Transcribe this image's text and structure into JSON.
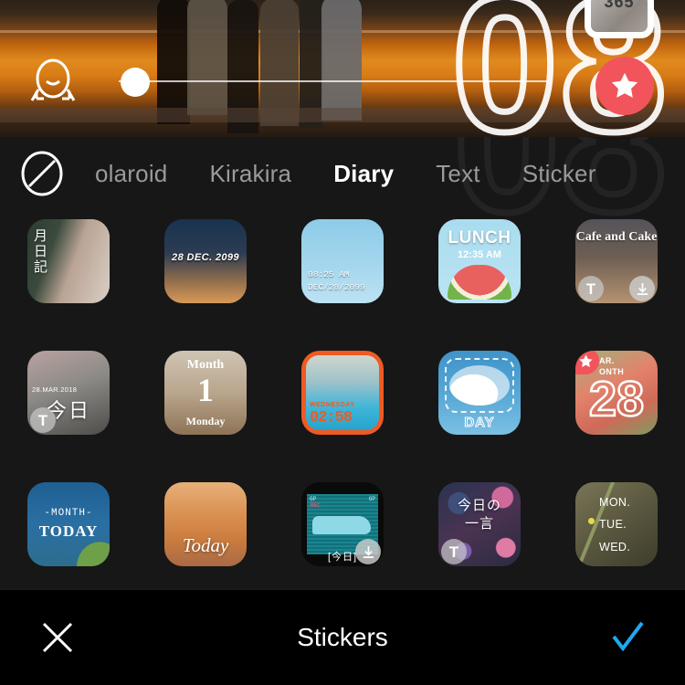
{
  "preview": {
    "overlay_number": "08",
    "badge_thumb_label": "365",
    "face_icon": "smile-face-icon",
    "star_icon": "star-icon",
    "slider": {
      "name": "opacity-slider",
      "value": 0
    }
  },
  "tabs": {
    "none_icon": "no-effect-icon",
    "items": [
      {
        "label": "olaroid",
        "active": false,
        "clipped": true
      },
      {
        "label": "Kirakira",
        "active": false
      },
      {
        "label": "Diary",
        "active": true
      },
      {
        "label": "Text",
        "active": false
      },
      {
        "label": "Sticker",
        "active": false
      }
    ]
  },
  "grid": {
    "selected_index": 9,
    "selection_color": "#29a9ee",
    "items": [
      {
        "name": "sticker-vertical-jp-portrait",
        "text": "月日記",
        "badges": []
      },
      {
        "name": "sticker-28-dec-2099",
        "text": "28 DEC. 2099",
        "badges": []
      },
      {
        "name": "sticker-time-date-palm",
        "time": "08:25 AM",
        "date": "DEC/28/2099",
        "badges": []
      },
      {
        "name": "sticker-lunch-watermelon",
        "title": "LUNCH",
        "time": "12:35 AM",
        "badges": []
      },
      {
        "name": "sticker-cafe-and-cake",
        "text": "Cafe and Cake",
        "badges": [
          "T",
          "download"
        ]
      },
      {
        "name": "sticker-kyou-clock",
        "date": "28.MAR.2018",
        "text": "今日",
        "badges": [
          "T"
        ]
      },
      {
        "name": "sticker-month-1-monday",
        "month": "Month",
        "day_number": "1",
        "weekday": "Monday",
        "badges": []
      },
      {
        "name": "sticker-wednesday-digital-clock",
        "weekday": "WEDNESDAY",
        "time": "02:58",
        "badges": []
      },
      {
        "name": "sticker-cloud-day",
        "label": "DAY",
        "badges": []
      },
      {
        "name": "sticker-mar-month-28",
        "line1": "AR.",
        "line2": "ONTH",
        "number": "28",
        "badges": [
          "star"
        ]
      },
      {
        "name": "sticker-month-today-palm",
        "line1": "-MONTH-",
        "line2": "TODAY",
        "badges": []
      },
      {
        "name": "sticker-today-burger",
        "text": "Today",
        "badges": []
      },
      {
        "name": "sticker-retro-camcorder-kyou",
        "rec": "REC",
        "tl": "GP",
        "tr": "GP",
        "text": "[今日]",
        "badges": [
          "download"
        ]
      },
      {
        "name": "sticker-kyou-no-hitokoto",
        "line1": "今日の",
        "line2": "一言",
        "badges": [
          "T"
        ]
      },
      {
        "name": "sticker-mon-tue-wed",
        "days": "MON.\nTUE.\nWED.",
        "badges": []
      }
    ]
  },
  "bottombar": {
    "close_icon": "close-x-icon",
    "title": "Stickers",
    "confirm_icon": "check-icon",
    "confirm_color": "#1fa8f0"
  }
}
